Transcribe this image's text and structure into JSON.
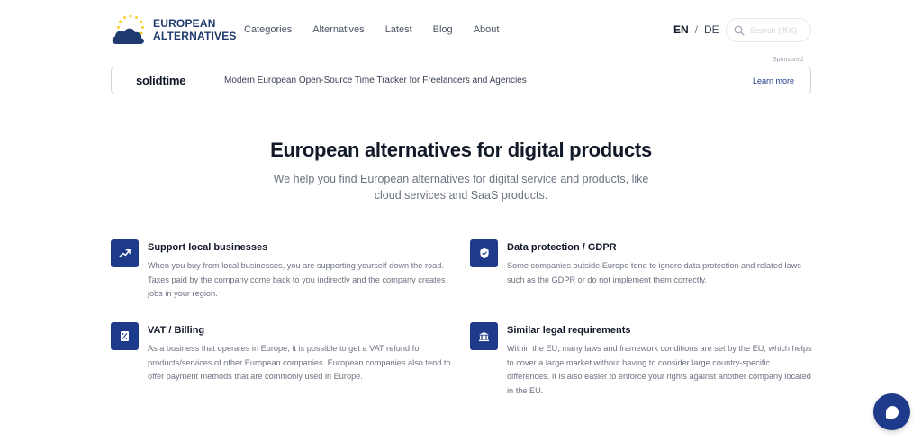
{
  "header": {
    "logo_line1": "EUROPEAN",
    "logo_line2": "ALTERNATIVES",
    "nav": [
      "Categories",
      "Alternatives",
      "Latest",
      "Blog",
      "About"
    ],
    "lang_en": "EN",
    "lang_sep": "/",
    "lang_de": "DE",
    "search_placeholder": "Search (⌘K)"
  },
  "sponsor": {
    "label": "Sponsored",
    "brand": "solidtime",
    "tagline": "Modern European Open-Source Time Tracker for Freelancers and Agencies",
    "cta": "Learn more"
  },
  "hero": {
    "title": "European alternatives for digital products",
    "subtitle": "We help you find European alternatives for digital service and products, like cloud services and SaaS products."
  },
  "features": [
    {
      "icon": "trend-up-icon",
      "title": "Support local businesses",
      "text": "When you buy from local businesses, you are supporting yourself down the road. Taxes paid by the company come back to you indirectly and the company creates jobs in your region."
    },
    {
      "icon": "shield-check-icon",
      "title": "Data protection / GDPR",
      "text": "Some companies outside Europe tend to ignore data protection and related laws such as the GDPR or do not implement them correctly."
    },
    {
      "icon": "receipt-percent-icon",
      "title": "VAT / Billing",
      "text": "As a business that operates in Europe, it is possible to get a VAT refund for products/services of other European companies. European companies also tend to offer payment methods that are commonly used in Europe."
    },
    {
      "icon": "bank-building-icon",
      "title": "Similar legal requirements",
      "text": "Within the EU, many laws and framework conditions are set by the EU, which helps to cover a large market without having to consider large country-specific differences. It is also easier to enforce your rights against another company located in the EU."
    }
  ],
  "colors": {
    "accent": "#1e3a8a",
    "star": "#facc15",
    "cloud": "#1e3a6e"
  }
}
